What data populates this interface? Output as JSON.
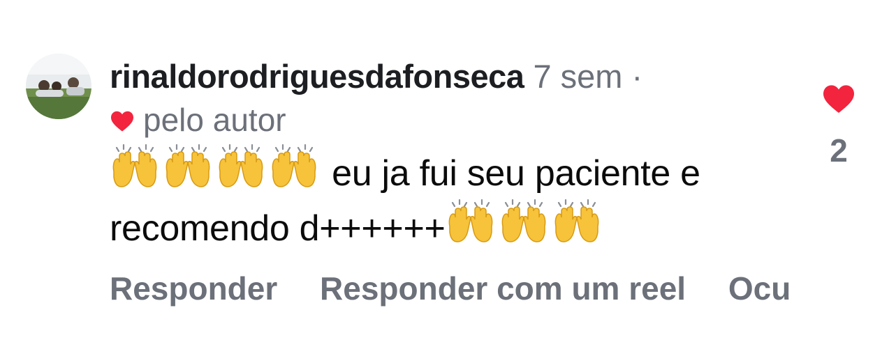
{
  "comment": {
    "username": "rinaldorodriguesdafonseca",
    "time": "7 sem",
    "separator": "·",
    "author_label": "pelo autor",
    "text_line1": "eu ja fui seu paciente e",
    "text_line2": "recomendo d++++++",
    "emoji_name": "raising-hands-emoji",
    "like_count": "2"
  },
  "actions": {
    "reply": "Responder",
    "reply_reel": "Responder com um reel",
    "hide": "Ocu"
  },
  "colors": {
    "heart": "#f2243e",
    "muted": "#6b7079",
    "text": "#0b0b0c"
  }
}
